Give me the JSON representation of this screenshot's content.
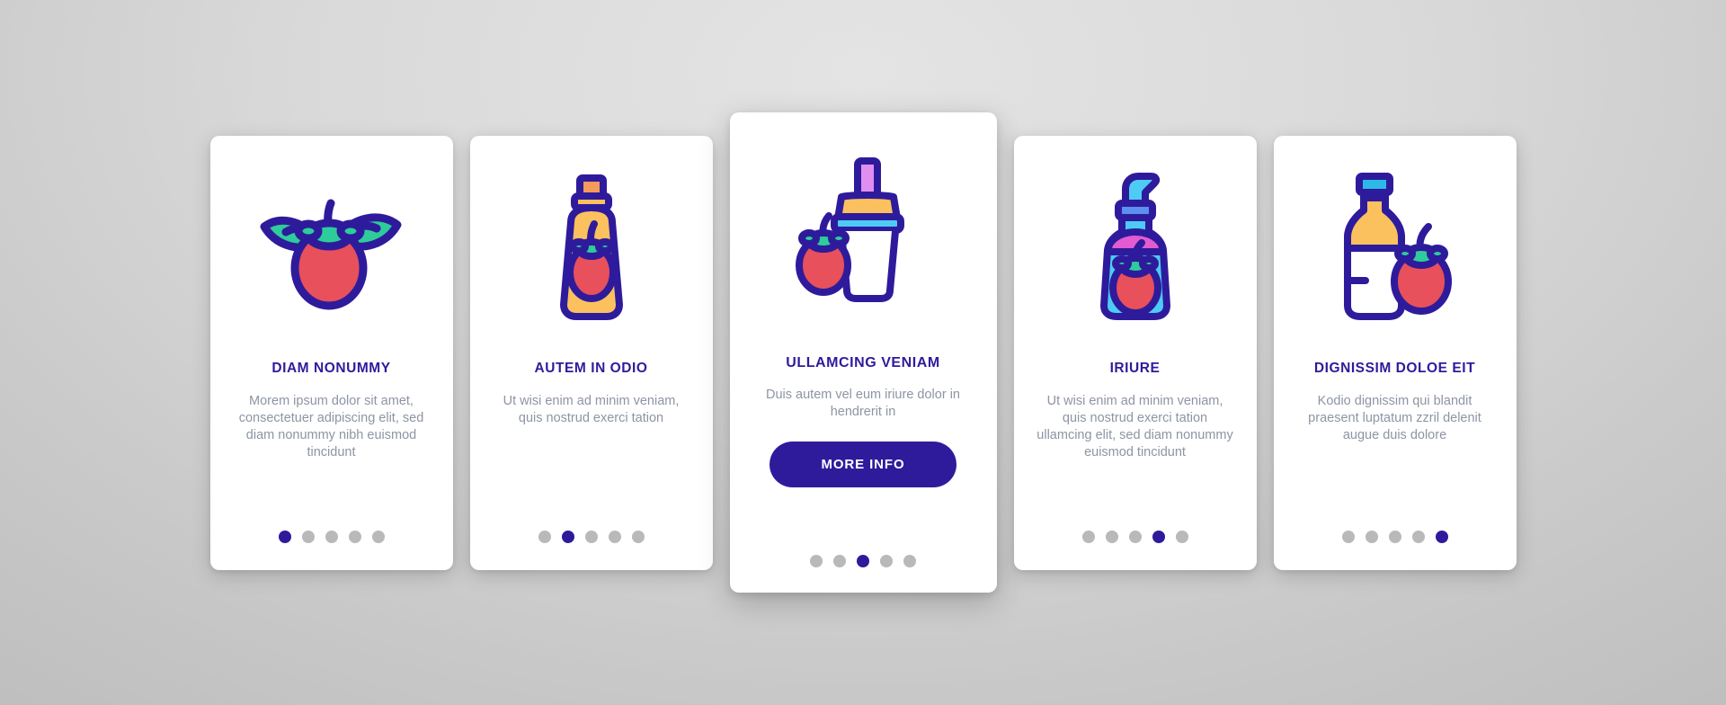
{
  "palette": {
    "accent": "#2e1b9c",
    "outline": "#2e1b9c",
    "tomato_red": "#e8505b",
    "leaf_green": "#2ecc9b",
    "yellow": "#fbc15e",
    "orange": "#f59a5a",
    "cyan": "#4ecbf5",
    "pink": "#e35bd0",
    "violet": "#d06ef0",
    "dot_inactive": "#b9b9b9",
    "card_bg": "#ffffff",
    "page_bg": "#d9d9d9"
  },
  "cards": [
    {
      "id": "card-1",
      "icon": "tomato-with-leaves-icon",
      "title": "DIAM NONUMMY",
      "body": "Morem ipsum dolor sit amet, consectetuer adipiscing elit, sed diam nonummy nibh euismod tincidunt",
      "featured": false,
      "dots": {
        "count": 5,
        "active_index": 0
      }
    },
    {
      "id": "card-2",
      "icon": "ketchup-squeeze-bottle-icon",
      "title": "AUTEM IN ODIO",
      "body": "Ut wisi enim ad minim veniam, quis nostrud exerci tation",
      "featured": false,
      "dots": {
        "count": 5,
        "active_index": 1
      }
    },
    {
      "id": "card-3",
      "icon": "tomato-juice-cup-with-straw-icon",
      "title": "ULLAMCING VENIAM",
      "body": "Duis autem vel eum iriure dolor in hendrerit in",
      "featured": true,
      "button_label": "MORE INFO",
      "dots": {
        "count": 5,
        "active_index": 2
      }
    },
    {
      "id": "card-4",
      "icon": "tomato-sauce-pump-bottle-icon",
      "title": "IRIURE",
      "body": "Ut wisi enim ad minim veniam, quis nostrud exerci tation ullamcing elit, sed diam nonummy euismod tincidunt",
      "featured": false,
      "dots": {
        "count": 5,
        "active_index": 3
      }
    },
    {
      "id": "card-5",
      "icon": "tomato-juice-bottle-icon",
      "title": "DIGNISSIM DOLOE EIT",
      "body": "Kodio dignissim qui blandit praesent luptatum zzril delenit augue duis dolore",
      "featured": false,
      "dots": {
        "count": 5,
        "active_index": 4
      }
    }
  ]
}
